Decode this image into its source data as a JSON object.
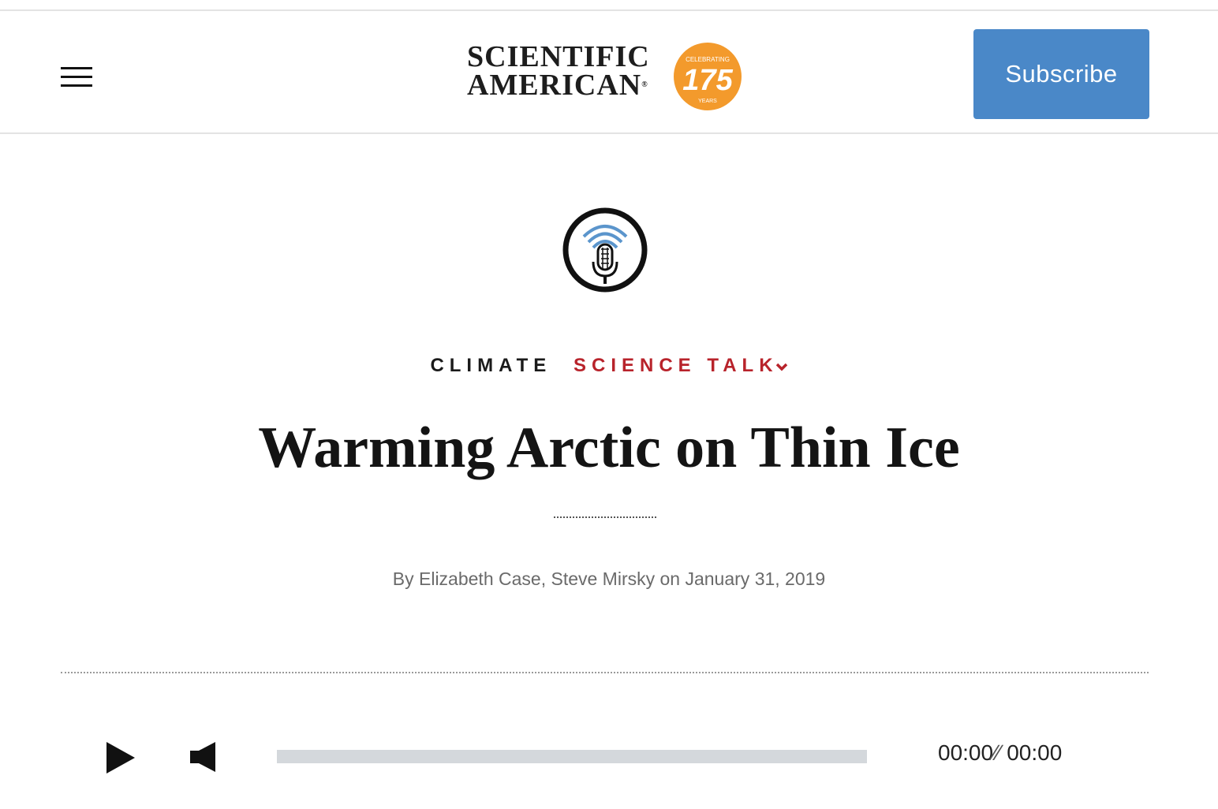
{
  "header": {
    "menu_icon": "hamburger-menu-icon",
    "logo": {
      "line1": "SCIENTIFIC",
      "line2": "AMERICAN",
      "registered": "®",
      "badge_top": "CELEBRATING",
      "badge_number": "175",
      "badge_bottom": "YEARS",
      "badge_color": "#f39a2c"
    },
    "subscribe_label": "Subscribe",
    "subscribe_color": "#4a88c8"
  },
  "article": {
    "podcast_icon": "podcast-microphone-icon",
    "category": "CLIMATE",
    "series": "SCIENCE TALK",
    "series_color": "#b8232b",
    "title": "Warming Arctic on Thin Ice",
    "byline": "By Elizabeth Case, Steve Mirsky on January 31, 2019"
  },
  "player": {
    "play_icon": "play-icon",
    "volume_icon": "volume-mute-icon",
    "progress": 0,
    "current_time": "00:00",
    "separator": "∕∕",
    "duration": "00:00"
  }
}
